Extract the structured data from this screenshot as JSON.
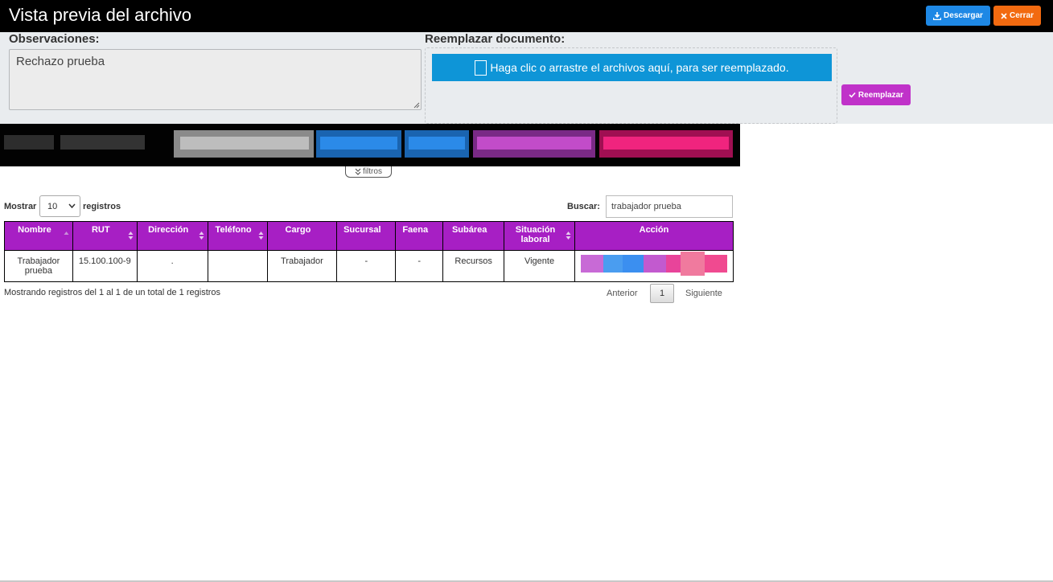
{
  "header": {
    "title": "Vista previa del archivo",
    "download_label": "Descargar",
    "close_label": "Cerrar"
  },
  "form": {
    "observations_label": "Observaciones:",
    "observations_value": "Rechazo prueba",
    "replace_label": "Reemplazar documento:",
    "dropzone_text": "Haga clic o arrastre el archivos aquí, para ser reemplazado.",
    "replace_button": "Reemplazar"
  },
  "filters": {
    "toggle_label": "filtros"
  },
  "table_controls": {
    "show_label": "Mostrar",
    "page_length": "10",
    "records_label": "registros",
    "search_label": "Buscar:",
    "search_value": "trabajador prueba"
  },
  "table": {
    "columns": [
      "Nombre",
      "RUT",
      "Dirección",
      "Teléfono",
      "Cargo",
      "Sucursal",
      "Faena",
      "Subárea",
      "Situación laboral",
      "Acción"
    ],
    "rows": [
      {
        "nombre": "Trabajador prueba",
        "rut": "15.100.100-9",
        "direccion": ".",
        "telefono": "",
        "cargo": "Trabajador",
        "sucursal": "-",
        "faena": "-",
        "subarea": "Recursos",
        "situacion": "Vigente"
      }
    ]
  },
  "footer": {
    "info": "Mostrando registros del 1 al 1 de un total de 1 registros",
    "prev": "Anterior",
    "current_page": "1",
    "next": "Siguiente"
  },
  "colors": {
    "header_bg": "#000000",
    "download": "#1e88e5",
    "close": "#f26a10",
    "dropzone": "#0e95d7",
    "replace": "#c032c9",
    "table_header": "#a71fc4"
  }
}
